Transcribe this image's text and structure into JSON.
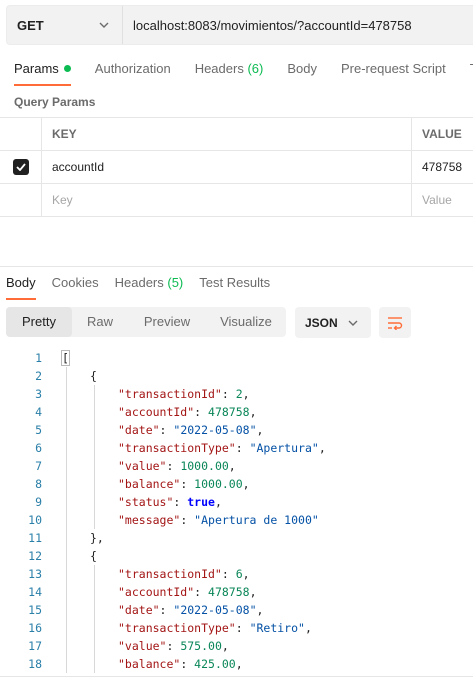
{
  "request": {
    "method": "GET",
    "url": "localhost:8083/movimientos/?accountId=478758"
  },
  "req_tabs": {
    "params": "Params",
    "authorization": "Authorization",
    "headers": "Headers",
    "headers_count": "(6)",
    "body": "Body",
    "prerequest": "Pre-request Script",
    "tests": "T"
  },
  "query_params": {
    "title": "Query Params",
    "col_key": "KEY",
    "col_value": "VALUE",
    "rows": [
      {
        "key": "accountId",
        "value": "478758",
        "checked": true
      }
    ],
    "placeholder_key": "Key",
    "placeholder_value": "Value"
  },
  "response": {
    "tabs": {
      "body": "Body",
      "cookies": "Cookies",
      "headers": "Headers",
      "headers_count": "(5)",
      "test_results": "Test Results"
    },
    "views": [
      "Pretty",
      "Raw",
      "Preview",
      "Visualize"
    ],
    "active_view": "Pretty",
    "format": "JSON"
  },
  "code_lines": [
    {
      "n": "1",
      "indent": 0,
      "parts": [
        [
          "p",
          "["
        ]
      ]
    },
    {
      "n": "2",
      "indent": 1,
      "parts": [
        [
          "p",
          "{"
        ]
      ]
    },
    {
      "n": "3",
      "indent": 2,
      "parts": [
        [
          "k",
          "\"transactionId\""
        ],
        [
          "p",
          ": "
        ],
        [
          "n",
          "2"
        ],
        [
          "p",
          ","
        ]
      ]
    },
    {
      "n": "4",
      "indent": 2,
      "parts": [
        [
          "k",
          "\"accountId\""
        ],
        [
          "p",
          ": "
        ],
        [
          "n",
          "478758"
        ],
        [
          "p",
          ","
        ]
      ]
    },
    {
      "n": "5",
      "indent": 2,
      "parts": [
        [
          "k",
          "\"date\""
        ],
        [
          "p",
          ": "
        ],
        [
          "s",
          "\"2022-05-08\""
        ],
        [
          "p",
          ","
        ]
      ]
    },
    {
      "n": "6",
      "indent": 2,
      "parts": [
        [
          "k",
          "\"transactionType\""
        ],
        [
          "p",
          ": "
        ],
        [
          "s",
          "\"Apertura\""
        ],
        [
          "p",
          ","
        ]
      ]
    },
    {
      "n": "7",
      "indent": 2,
      "parts": [
        [
          "k",
          "\"value\""
        ],
        [
          "p",
          ": "
        ],
        [
          "n",
          "1000.00"
        ],
        [
          "p",
          ","
        ]
      ]
    },
    {
      "n": "8",
      "indent": 2,
      "parts": [
        [
          "k",
          "\"balance\""
        ],
        [
          "p",
          ": "
        ],
        [
          "n",
          "1000.00"
        ],
        [
          "p",
          ","
        ]
      ]
    },
    {
      "n": "9",
      "indent": 2,
      "parts": [
        [
          "k",
          "\"status\""
        ],
        [
          "p",
          ": "
        ],
        [
          "b",
          "true"
        ],
        [
          "p",
          ","
        ]
      ]
    },
    {
      "n": "10",
      "indent": 2,
      "parts": [
        [
          "k",
          "\"message\""
        ],
        [
          "p",
          ": "
        ],
        [
          "s",
          "\"Apertura de 1000\""
        ]
      ]
    },
    {
      "n": "11",
      "indent": 1,
      "parts": [
        [
          "p",
          "},"
        ]
      ]
    },
    {
      "n": "12",
      "indent": 1,
      "parts": [
        [
          "p",
          "{"
        ]
      ]
    },
    {
      "n": "13",
      "indent": 2,
      "parts": [
        [
          "k",
          "\"transactionId\""
        ],
        [
          "p",
          ": "
        ],
        [
          "n",
          "6"
        ],
        [
          "p",
          ","
        ]
      ]
    },
    {
      "n": "14",
      "indent": 2,
      "parts": [
        [
          "k",
          "\"accountId\""
        ],
        [
          "p",
          ": "
        ],
        [
          "n",
          "478758"
        ],
        [
          "p",
          ","
        ]
      ]
    },
    {
      "n": "15",
      "indent": 2,
      "parts": [
        [
          "k",
          "\"date\""
        ],
        [
          "p",
          ": "
        ],
        [
          "s",
          "\"2022-05-08\""
        ],
        [
          "p",
          ","
        ]
      ]
    },
    {
      "n": "16",
      "indent": 2,
      "parts": [
        [
          "k",
          "\"transactionType\""
        ],
        [
          "p",
          ": "
        ],
        [
          "s",
          "\"Retiro\""
        ],
        [
          "p",
          ","
        ]
      ]
    },
    {
      "n": "17",
      "indent": 2,
      "parts": [
        [
          "k",
          "\"value\""
        ],
        [
          "p",
          ": "
        ],
        [
          "n",
          "575.00"
        ],
        [
          "p",
          ","
        ]
      ]
    },
    {
      "n": "18",
      "indent": 2,
      "parts": [
        [
          "k",
          "\"balance\""
        ],
        [
          "p",
          ": "
        ],
        [
          "n",
          "425.00"
        ],
        [
          "p",
          ","
        ]
      ]
    }
  ],
  "colors": {
    "accent": "#ff6c37",
    "active_dot": "#0cbb52",
    "line_number": "#2a7fa8",
    "json_key": "#a31515",
    "json_string": "#0451a5",
    "json_number": "#098658",
    "json_boolean": "#0000ff"
  },
  "icons": {
    "method_dropdown": "chevron-down-icon",
    "format_dropdown": "chevron-down-icon",
    "wrap": "wrap-lines-icon",
    "checkbox": "checkmark-icon"
  }
}
